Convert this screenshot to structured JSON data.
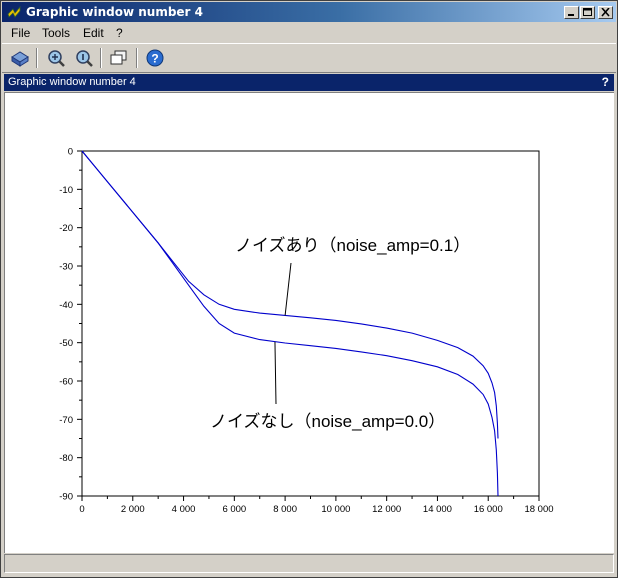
{
  "window": {
    "title": "Graphic window number 4",
    "subheader_title": "Graphic window number 4",
    "help_mark": "?"
  },
  "menu": {
    "items": [
      {
        "label": "File"
      },
      {
        "label": "Tools"
      },
      {
        "label": "Edit"
      },
      {
        "label": "?"
      }
    ]
  },
  "toolbar": {
    "buttons": [
      {
        "icon": "rotate-3d-icon"
      },
      {
        "icon": "zoom-icon"
      },
      {
        "icon": "unzoom-icon"
      },
      {
        "icon": "datatip-icon"
      },
      {
        "icon": "help-icon"
      }
    ]
  },
  "chart_data": {
    "type": "line",
    "title": "",
    "xlabel": "",
    "ylabel": "",
    "xlim": [
      0,
      18000
    ],
    "ylim": [
      -90,
      0
    ],
    "x_ticks": [
      0,
      2000,
      4000,
      6000,
      8000,
      10000,
      12000,
      14000,
      16000,
      18000
    ],
    "x_tick_labels": [
      "0",
      "2 000",
      "4 000",
      "6 000",
      "8 000",
      "10 000",
      "12 000",
      "14 000",
      "16 000",
      "18 000"
    ],
    "y_ticks": [
      0,
      -10,
      -20,
      -30,
      -40,
      -50,
      -60,
      -70,
      -80,
      -90
    ],
    "y_tick_labels": [
      "0",
      "-10",
      "-20",
      "-30",
      "-40",
      "-50",
      "-60",
      "-70",
      "-80",
      "-90"
    ],
    "grid": false,
    "line_color": "#0000cc",
    "series": [
      {
        "x": [
          0,
          500,
          1000,
          2000,
          3000,
          3600,
          4200,
          4800,
          5400,
          6000,
          7000,
          8000,
          9000,
          10000,
          11000,
          12000,
          13000,
          14000,
          14800,
          15400,
          15800,
          16000,
          16150,
          16250,
          16320,
          16360,
          16384
        ],
        "y": [
          0,
          -4,
          -8,
          -16,
          -24,
          -29,
          -34,
          -37.5,
          -40,
          -41.3,
          -42.3,
          -42.9,
          -43.5,
          -44.2,
          -45.1,
          -46.2,
          -47.5,
          -49.4,
          -51.3,
          -53.5,
          -56,
          -58,
          -60.5,
          -63,
          -66.5,
          -71,
          -75
        ]
      },
      {
        "x": [
          0,
          500,
          1000,
          2000,
          3000,
          3600,
          4200,
          4800,
          5400,
          6000,
          7000,
          8000,
          9000,
          10000,
          11000,
          12000,
          13000,
          14000,
          14800,
          15400,
          15800,
          16000,
          16150,
          16250,
          16320,
          16360,
          16384
        ],
        "y": [
          0,
          -4,
          -8,
          -16,
          -24,
          -29.5,
          -35,
          -40.5,
          -45,
          -47.5,
          -49.2,
          -50.1,
          -50.8,
          -51.5,
          -52.4,
          -53.4,
          -54.7,
          -56.3,
          -58.3,
          -60.8,
          -63.5,
          -66,
          -69.5,
          -73,
          -78,
          -84,
          -90
        ]
      }
    ],
    "annotations": [
      {
        "text": "ノイズあり（noise_amp=0.1）",
        "target": [
          8000,
          -42.9
        ]
      },
      {
        "text": "ノイズなし（noise_amp=0.0）",
        "target": [
          7600,
          -49.8
        ]
      }
    ]
  }
}
